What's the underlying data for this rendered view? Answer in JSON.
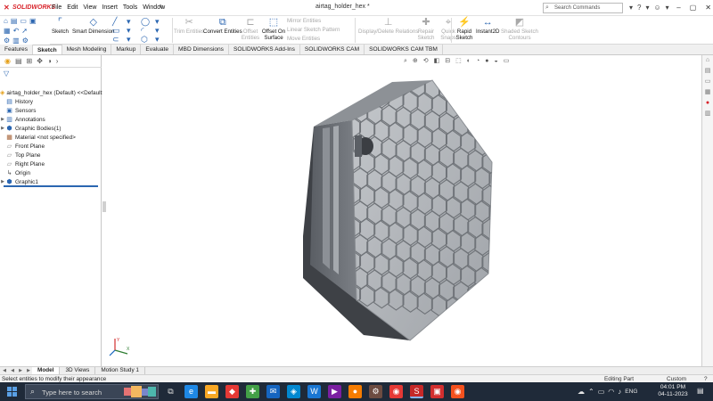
{
  "app": {
    "brand": "SOLIDWORKS",
    "document_title": "airtag_holder_hex *",
    "menu": [
      "File",
      "Edit",
      "View",
      "Insert",
      "Tools",
      "Window"
    ],
    "search_placeholder": "Search Commands"
  },
  "command_manager": {
    "sketch_label": "Sketch",
    "smart_dimension_label": "Smart Dimension",
    "trim_entities_label": "Trim Entities",
    "convert_entities_label": "Convert Entities",
    "offset_entities_label": "Offset Entities",
    "offset_on_surface_label": "Offset On Surface",
    "mirror_entities_label": "Mirror Entities",
    "linear_sketch_pattern_label": "Linear Sketch Pattern",
    "move_entities_label": "Move Entities",
    "display_delete_relations_label": "Display/Delete Relations",
    "repair_sketch_label": "Repair Sketch",
    "quick_snaps_label": "Quick Snaps",
    "rapid_sketch_label": "Rapid Sketch",
    "instant2d_label": "Instant2D",
    "shaded_sketch_contours_label": "Shaded Sketch Contours"
  },
  "tabs": [
    {
      "label": "Features",
      "active": false
    },
    {
      "label": "Sketch",
      "active": true
    },
    {
      "label": "Mesh Modeling",
      "active": false
    },
    {
      "label": "Markup",
      "active": false
    },
    {
      "label": "Evaluate",
      "active": false
    },
    {
      "label": "MBD Dimensions",
      "active": false
    },
    {
      "label": "SOLIDWORKS Add-Ins",
      "active": false
    },
    {
      "label": "SOLIDWORKS CAM",
      "active": false
    },
    {
      "label": "SOLIDWORKS CAM TBM",
      "active": false
    }
  ],
  "feature_tree": [
    {
      "label": "airtag_holder_hex (Default) <<Default>",
      "icon": "part-icon",
      "expandable": false
    },
    {
      "label": "History",
      "icon": "history-icon",
      "expandable": false
    },
    {
      "label": "Sensors",
      "icon": "sensors-icon",
      "expandable": false
    },
    {
      "label": "Annotations",
      "icon": "annotations-icon",
      "expandable": true
    },
    {
      "label": "Graphic Bodies(1)",
      "icon": "graphic-bodies-icon",
      "expandable": true
    },
    {
      "label": "Material <not specified>",
      "icon": "material-icon",
      "expandable": false
    },
    {
      "label": "Front Plane",
      "icon": "plane-icon",
      "expandable": false
    },
    {
      "label": "Top Plane",
      "icon": "plane-icon",
      "expandable": false
    },
    {
      "label": "Right Plane",
      "icon": "plane-icon",
      "expandable": false
    },
    {
      "label": "Origin",
      "icon": "origin-icon",
      "expandable": false
    },
    {
      "label": "Graphic1",
      "icon": "graphic-body-icon",
      "expandable": true
    }
  ],
  "bottom_tabs": [
    {
      "label": "Model",
      "active": true
    },
    {
      "label": "3D Views",
      "active": false
    },
    {
      "label": "Motion Study 1",
      "active": false
    }
  ],
  "status": {
    "message": "Select entities to modify their appearance",
    "mode": "Editing Part",
    "units": "Custom"
  },
  "taskbar": {
    "search_placeholder": "Type here to search",
    "language": "ENG",
    "time": "04:01 PM",
    "date": "04-11-2023"
  },
  "colors": {
    "accent": "#2b66b1",
    "brand_red": "#d8232a",
    "taskbar": "#1f2a39",
    "model_face": "#b3b6ba",
    "model_side_dark": "#4a4d52"
  }
}
